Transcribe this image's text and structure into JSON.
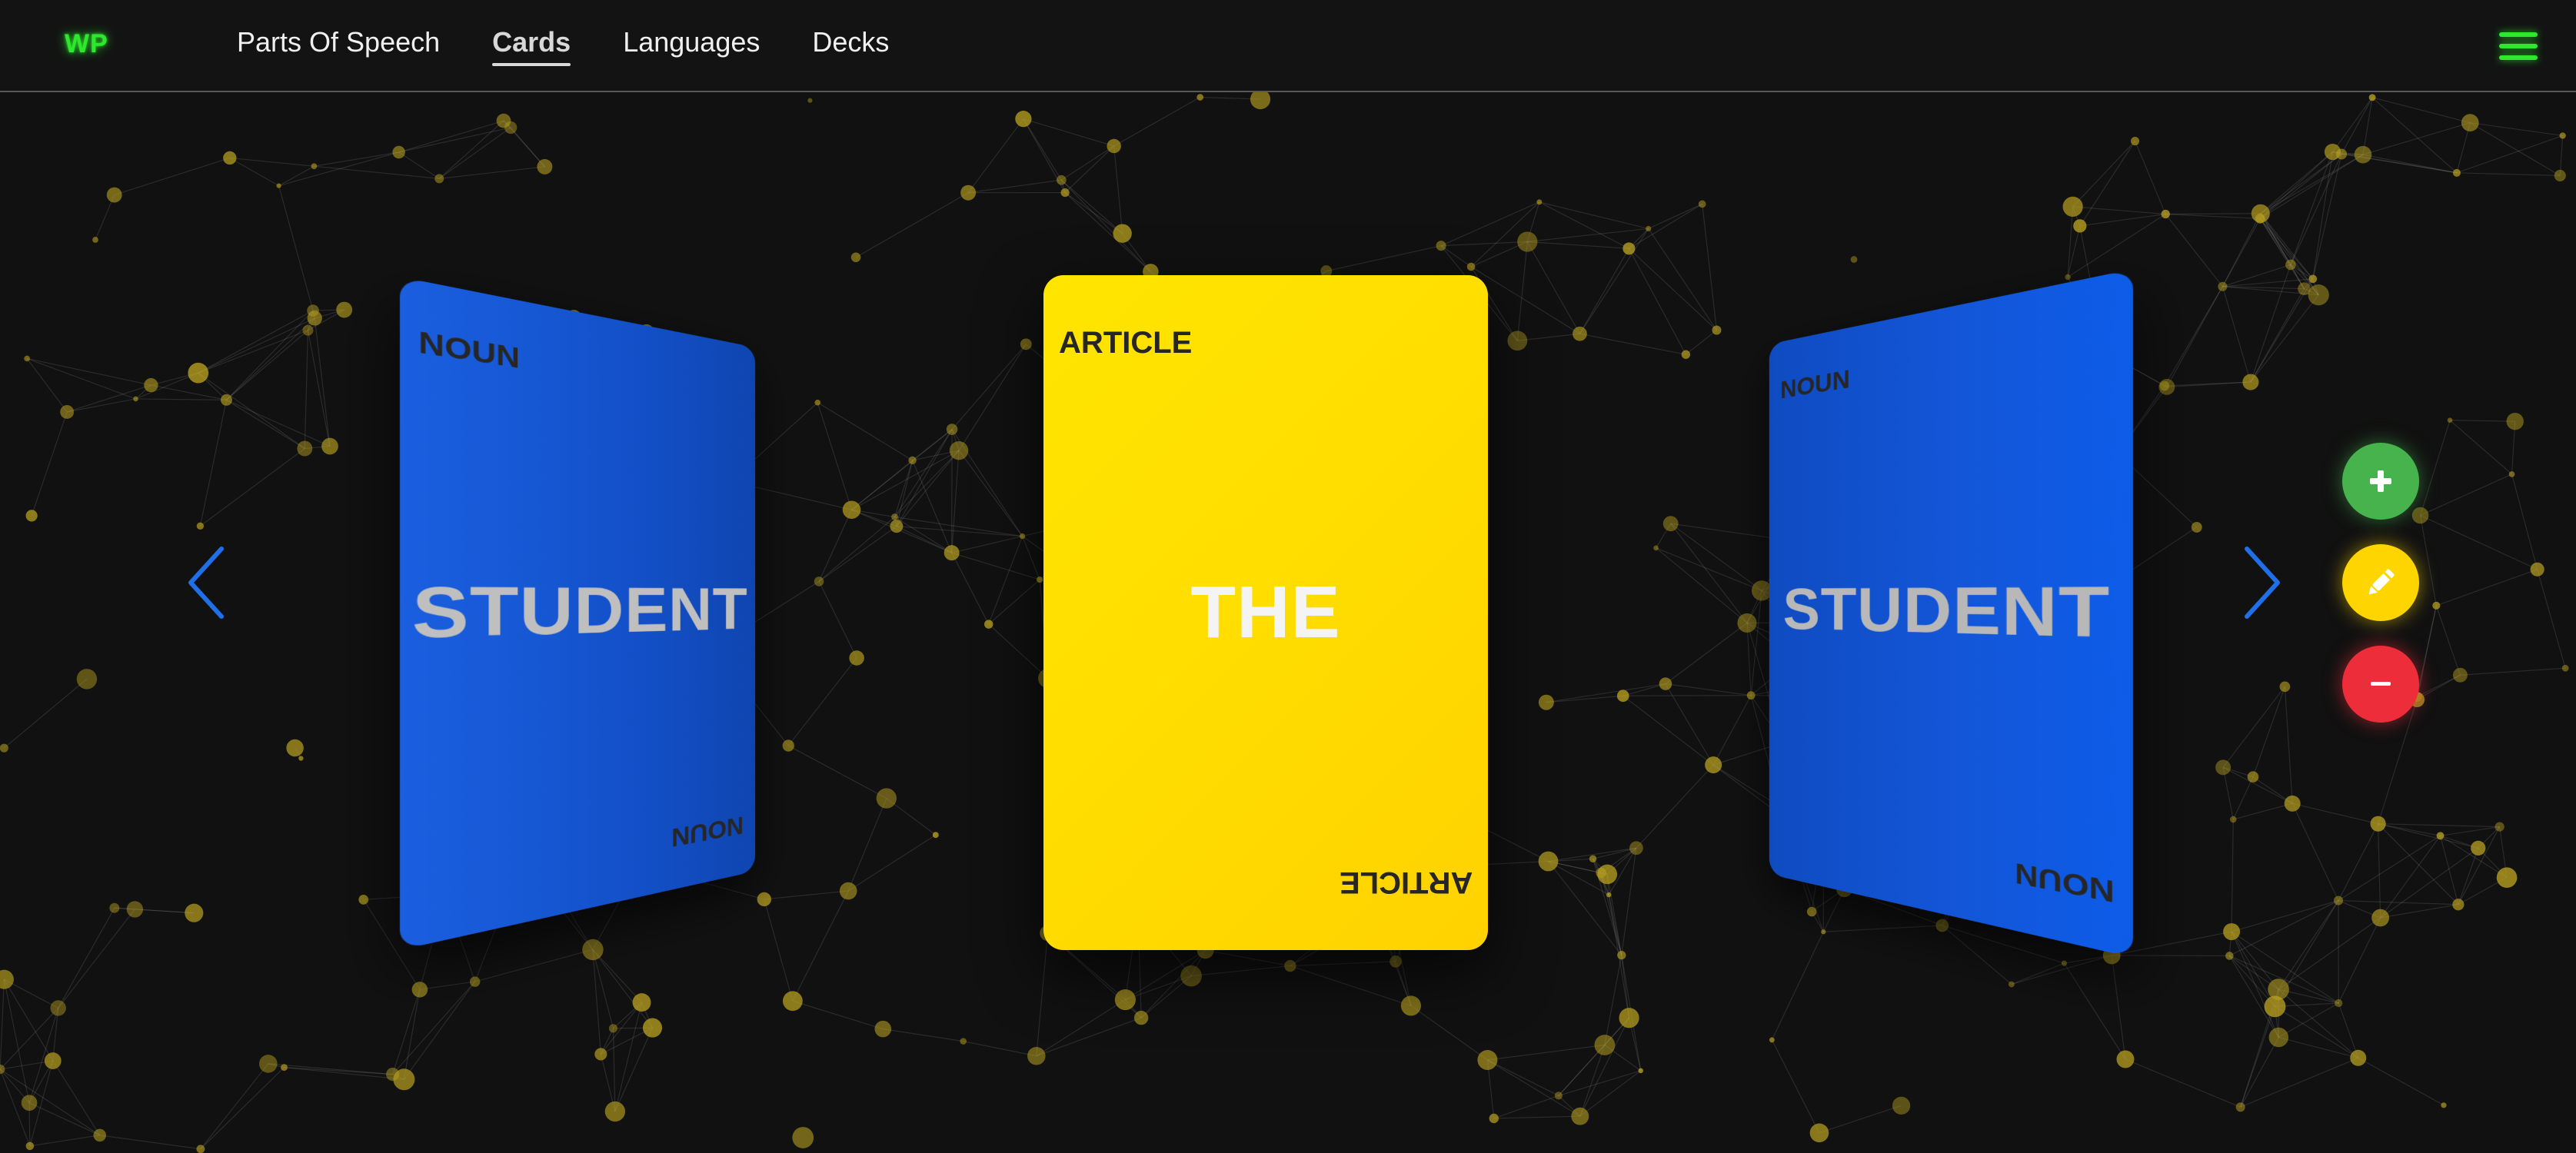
{
  "app": {
    "logo": "WP"
  },
  "nav": {
    "items": [
      {
        "label": "Parts Of Speech",
        "active": false
      },
      {
        "label": "Cards",
        "active": true
      },
      {
        "label": "Languages",
        "active": false
      },
      {
        "label": "Decks",
        "active": false
      }
    ]
  },
  "carousel": {
    "cards": [
      {
        "word": "STUDENT",
        "part_of_speech": "NOUN",
        "color": "#1a5fe0"
      },
      {
        "word": "THE",
        "part_of_speech": "ARTICLE",
        "color": "#ffdd00"
      },
      {
        "word": "STUDENT",
        "part_of_speech": "NOUN",
        "color": "#1356d8"
      }
    ]
  },
  "actions": {
    "add_icon": "plus-icon",
    "edit_icon": "pencil-icon",
    "remove_icon": "minus-icon"
  },
  "colors": {
    "background": "#111111",
    "brand_green": "#2ee82e",
    "network_node": "#b8a020",
    "arrow_blue": "#1e6fe8",
    "add": "#46b34d",
    "edit": "#ffd500",
    "remove": "#ee2d3a"
  }
}
